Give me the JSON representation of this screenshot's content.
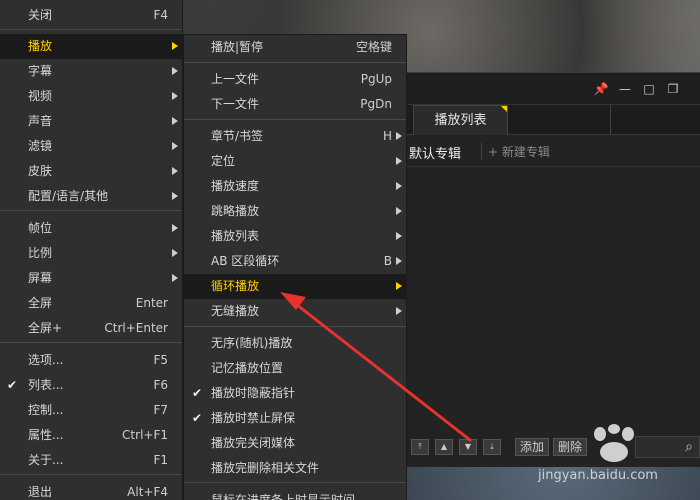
{
  "main_menu": {
    "items": [
      {
        "label": "关闭",
        "shortcut": "F4",
        "arrow": false
      },
      {
        "label": "播放",
        "shortcut": "",
        "arrow": true,
        "highlighted": true
      },
      {
        "label": "字幕",
        "shortcut": "",
        "arrow": true
      },
      {
        "label": "视频",
        "shortcut": "",
        "arrow": true
      },
      {
        "label": "声音",
        "shortcut": "",
        "arrow": true
      },
      {
        "label": "滤镜",
        "shortcut": "",
        "arrow": true
      },
      {
        "label": "皮肤",
        "shortcut": "",
        "arrow": true
      },
      {
        "label": "配置/语言/其他",
        "shortcut": "",
        "arrow": true
      },
      {
        "label": "帧位",
        "shortcut": "",
        "arrow": true
      },
      {
        "label": "比例",
        "shortcut": "",
        "arrow": true
      },
      {
        "label": "屏幕",
        "shortcut": "",
        "arrow": true
      },
      {
        "label": "全屏",
        "shortcut": "Enter",
        "arrow": false
      },
      {
        "label": "全屏+",
        "shortcut": "Ctrl+Enter",
        "arrow": false
      },
      {
        "label": "选项...",
        "shortcut": "F5",
        "arrow": false
      },
      {
        "label": "列表...",
        "shortcut": "F6",
        "arrow": false,
        "checked": true
      },
      {
        "label": "控制...",
        "shortcut": "F7",
        "arrow": false
      },
      {
        "label": "属性...",
        "shortcut": "Ctrl+F1",
        "arrow": false
      },
      {
        "label": "关于...",
        "shortcut": "F1",
        "arrow": false
      },
      {
        "label": "退出",
        "shortcut": "Alt+F4",
        "arrow": false
      }
    ]
  },
  "play_submenu": {
    "items": [
      {
        "label": "播放|暂停",
        "shortcut": "空格键",
        "arrow": false
      },
      {
        "label": "上一文件",
        "shortcut": "PgUp",
        "arrow": false
      },
      {
        "label": "下一文件",
        "shortcut": "PgDn",
        "arrow": false
      },
      {
        "label": "章节/书签",
        "shortcut": "H",
        "arrow": true
      },
      {
        "label": "定位",
        "shortcut": "",
        "arrow": true
      },
      {
        "label": "播放速度",
        "shortcut": "",
        "arrow": true
      },
      {
        "label": "跳略播放",
        "shortcut": "",
        "arrow": true
      },
      {
        "label": "播放列表",
        "shortcut": "",
        "arrow": true
      },
      {
        "label": "AB 区段循环",
        "shortcut": "B",
        "arrow": true
      },
      {
        "label": "循环播放",
        "shortcut": "",
        "arrow": true,
        "highlighted": true
      },
      {
        "label": "无缝播放",
        "shortcut": "",
        "arrow": true
      },
      {
        "label": "无序(随机)播放",
        "shortcut": "",
        "arrow": false
      },
      {
        "label": "记忆播放位置",
        "shortcut": "",
        "arrow": false
      },
      {
        "label": "播放时隐蔽指针",
        "shortcut": "",
        "arrow": false,
        "checked": true
      },
      {
        "label": "播放时禁止屏保",
        "shortcut": "",
        "arrow": false,
        "checked": true
      },
      {
        "label": "播放完关闭媒体",
        "shortcut": "",
        "arrow": false
      },
      {
        "label": "播放完删除相关文件",
        "shortcut": "",
        "arrow": false
      },
      {
        "label": "鼠标在进度条上时显示时间",
        "shortcut": "",
        "arrow": false
      }
    ]
  },
  "playlist": {
    "tab_label": "播放列表",
    "album_default": "默认专辑",
    "album_new": "+ 新建专辑",
    "add_label": "添加",
    "delete_label": "删除"
  },
  "watermark": {
    "text": "jingyan.baidu.com"
  },
  "colors": {
    "highlight_text": "#ffd200",
    "menu_bg": "#2f2f2f",
    "annotation_arrow": "#e8322e"
  }
}
